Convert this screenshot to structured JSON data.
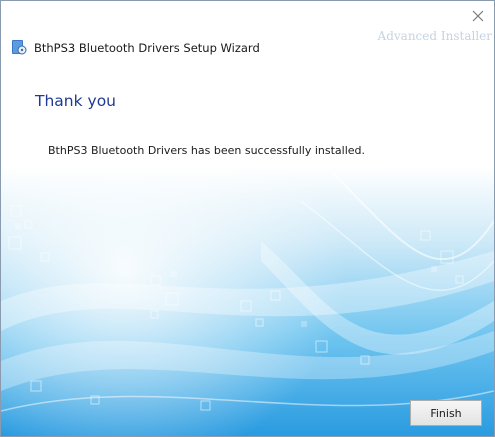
{
  "window": {
    "title": "BthPS3 Bluetooth Drivers Setup Wizard",
    "brand": "Advanced Installer"
  },
  "content": {
    "heading": "Thank you",
    "message": "BthPS3 Bluetooth Drivers has been successfully installed."
  },
  "buttons": {
    "finish": "Finish"
  },
  "icons": {
    "app": "installer-app-icon",
    "close": "close-icon"
  },
  "colors": {
    "heading": "#1f3a93",
    "background_accent": "#3fa9e6"
  }
}
